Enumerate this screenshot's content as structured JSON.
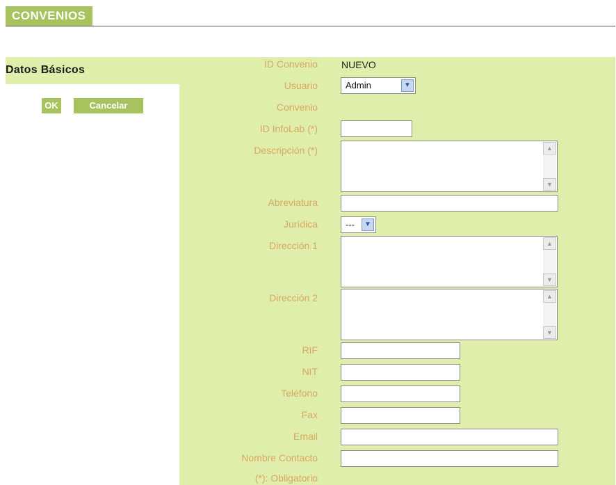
{
  "header": {
    "title": "CONVENIOS"
  },
  "sidebar": {
    "title": "Datos Básicos",
    "ok_label": "OK",
    "cancel_label": "Cancelar"
  },
  "form": {
    "id_convenio_label": "ID Convenio",
    "id_convenio_value": "NUEVO",
    "usuario_label": "Usuario",
    "usuario_value": "Admin",
    "convenio_label": "Convenio",
    "id_infolab_label": "ID InfoLab (*)",
    "descripcion_label": "Descripción (*)",
    "abreviatura_label": "Abreviatura",
    "juridica_label": "Jurídica",
    "juridica_value": "---",
    "direccion1_label": "Dirección 1",
    "direccion2_label": "Dirección 2",
    "rif_label": "RIF",
    "nit_label": "NIT",
    "telefono_label": "Teléfono",
    "fax_label": "Fax",
    "email_label": "Email",
    "nombre_contacto_label": "Nombre Contacto",
    "required_note": "(*): Obligatorio"
  },
  "colors": {
    "accent": "#a7c35e",
    "panel_bg": "#dfeeaa",
    "label_text": "#d8a764"
  },
  "icons": {
    "scroll_up": "▲",
    "scroll_down": "▼",
    "dropdown": "▼"
  }
}
